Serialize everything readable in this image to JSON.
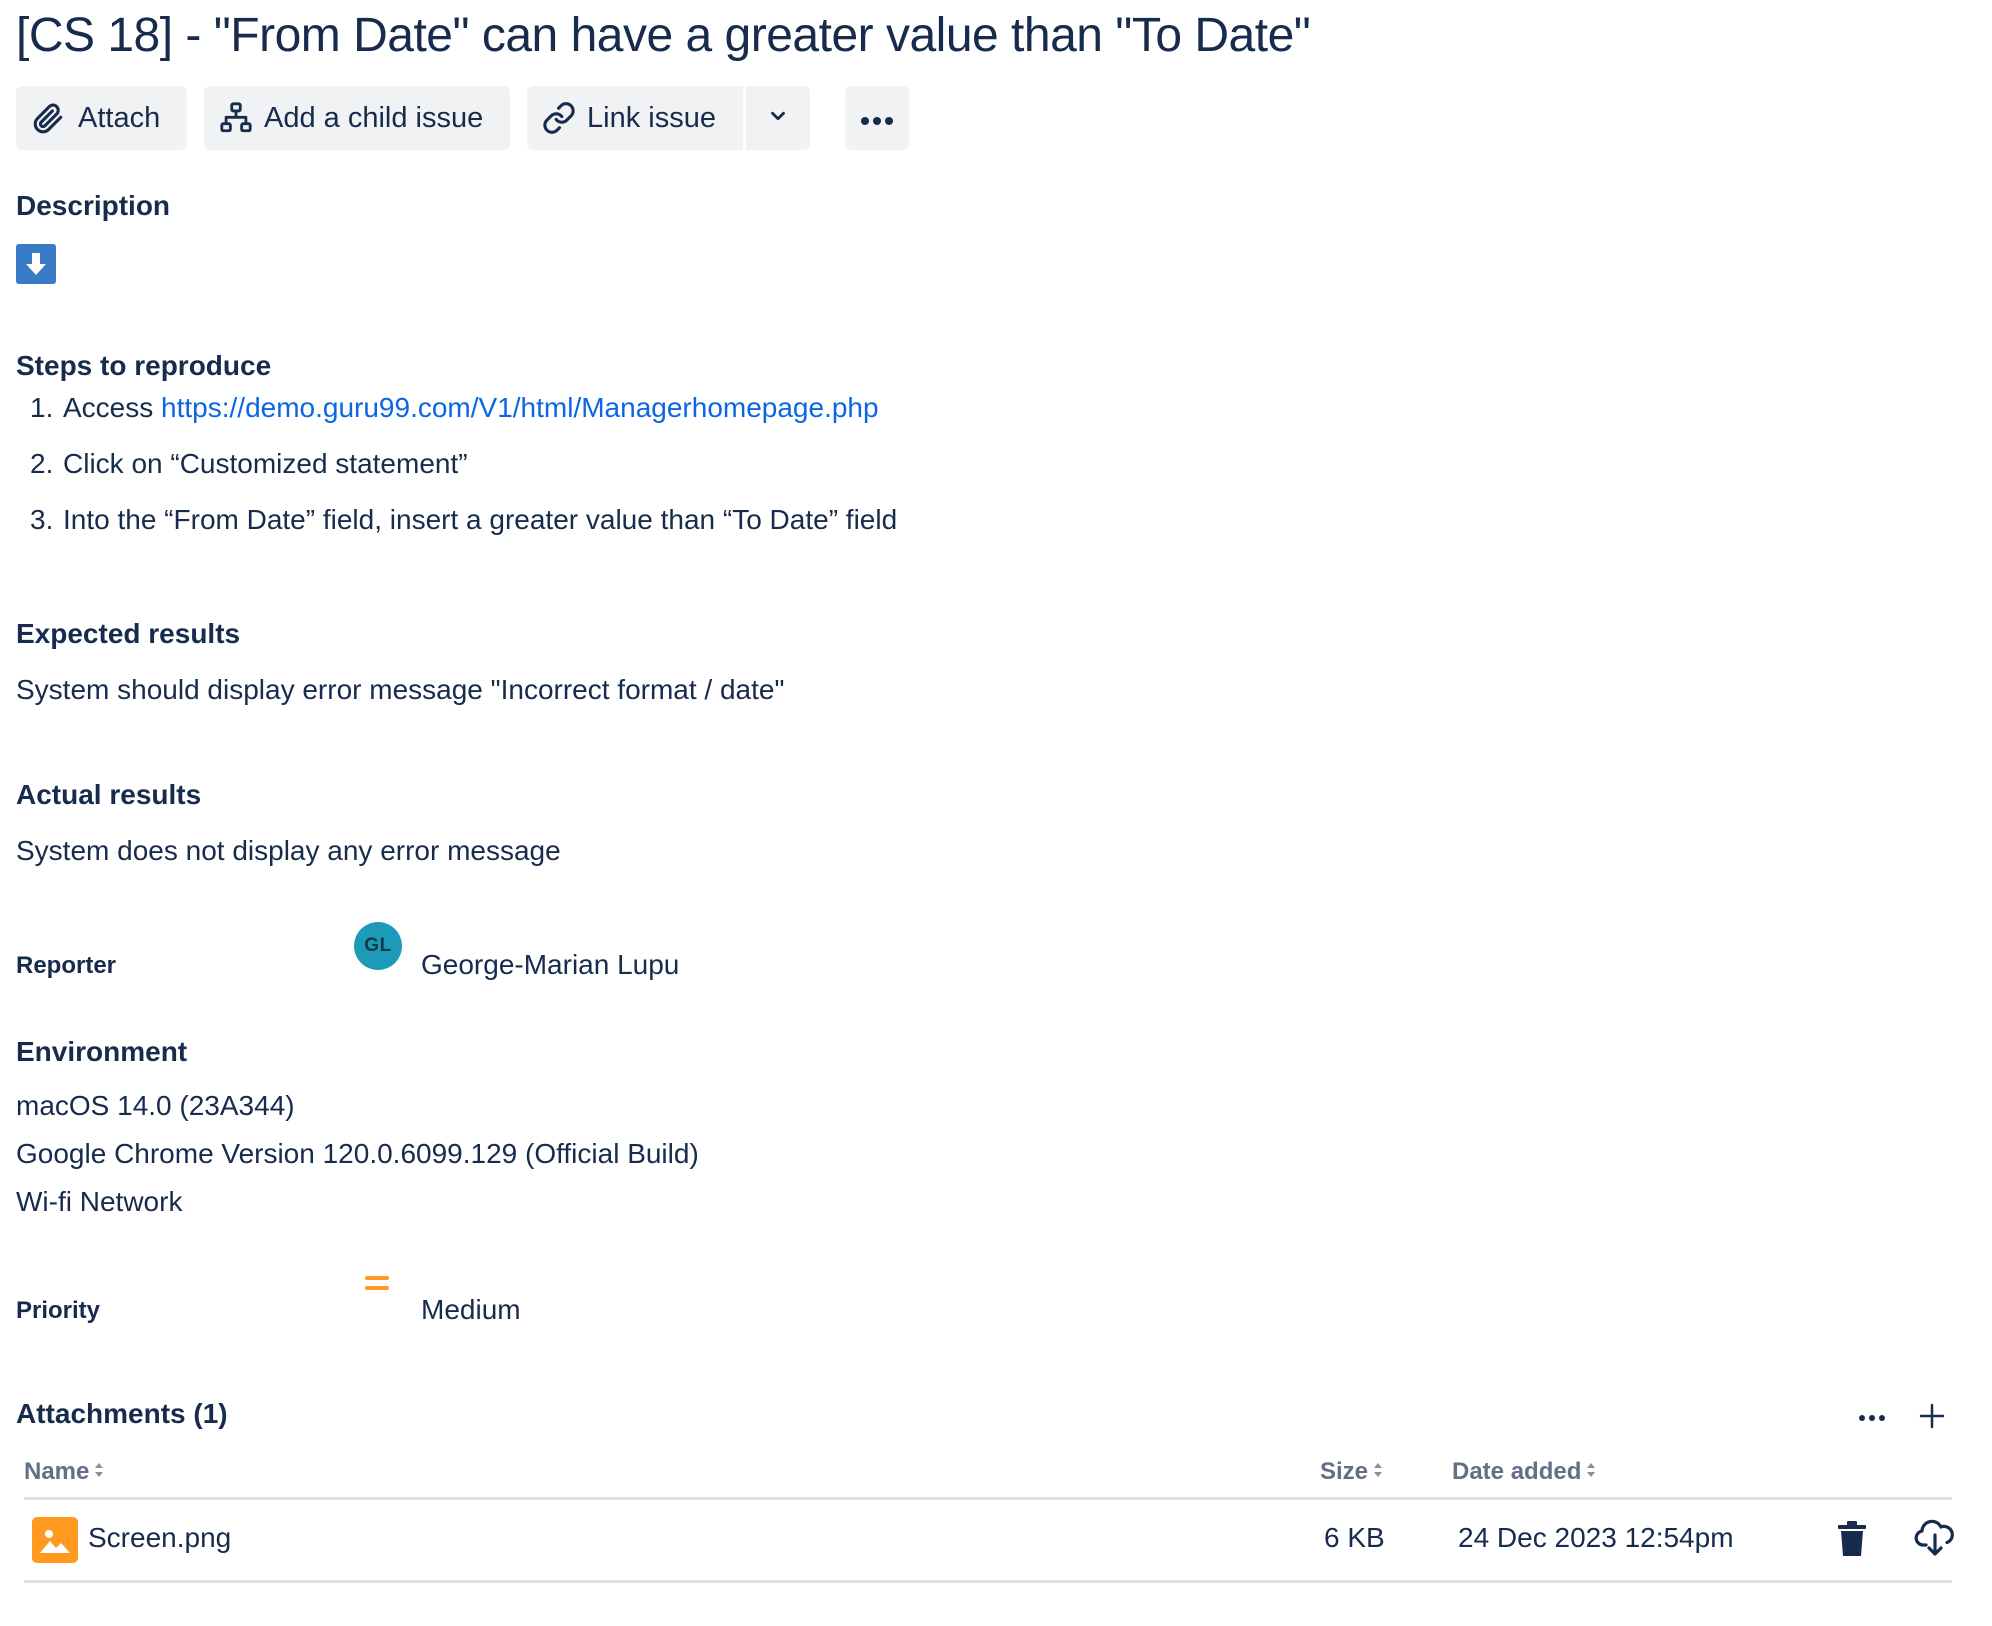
{
  "issue": {
    "title": "[CS 18] - \"From Date\" can have a greater value than \"To Date\""
  },
  "toolbar": {
    "attach_label": "Attach",
    "add_child_label": "Add a child issue",
    "link_issue_label": "Link issue",
    "icons": {
      "attach": "paperclip-icon",
      "child": "child-issue-icon",
      "link": "link-icon",
      "dropdown": "chevron-down-icon",
      "more": "more-horizontal-icon"
    }
  },
  "description": {
    "heading": "Description",
    "emoji": "down-arrow-icon",
    "steps_heading": "Steps to reproduce",
    "steps": [
      {
        "num": "1.",
        "text": "Access ",
        "link": "https://demo.guru99.com/V1/html/Managerhomepage.php"
      },
      {
        "num": "2.",
        "text": "Click on “Customized statement”"
      },
      {
        "num": "3.",
        "text": "Into the “From Date” field, insert a greater value than “To Date” field"
      }
    ],
    "expected_heading": "Expected results",
    "expected_text": "System should display error message \"Incorrect format / date\"",
    "actual_heading": "Actual results",
    "actual_text": "System does not display any error message"
  },
  "reporter": {
    "label": "Reporter",
    "initials": "GL",
    "name": "George-Marian Lupu",
    "avatar_color": "#1d9ab8"
  },
  "environment": {
    "heading": "Environment",
    "lines": [
      "macOS 14.0 (23A344)",
      "Google Chrome Version 120.0.6099.129 (Official Build)",
      "Wi-fi Network"
    ]
  },
  "priority": {
    "label": "Priority",
    "value": "Medium",
    "icon": "priority-medium-icon",
    "color": "#ff991f"
  },
  "attachments": {
    "heading": "Attachments (1)",
    "columns": {
      "name": "Name",
      "size": "Size",
      "date": "Date added"
    },
    "rows": [
      {
        "name": "Screen.png",
        "size": "6 KB",
        "date": "24 Dec 2023 12:54pm",
        "icon": "image-file-icon"
      }
    ]
  },
  "colors": {
    "text": "#172b4d",
    "link": "#0c66e4",
    "button_bg": "#f1f2f4",
    "muted": "#626f86"
  }
}
